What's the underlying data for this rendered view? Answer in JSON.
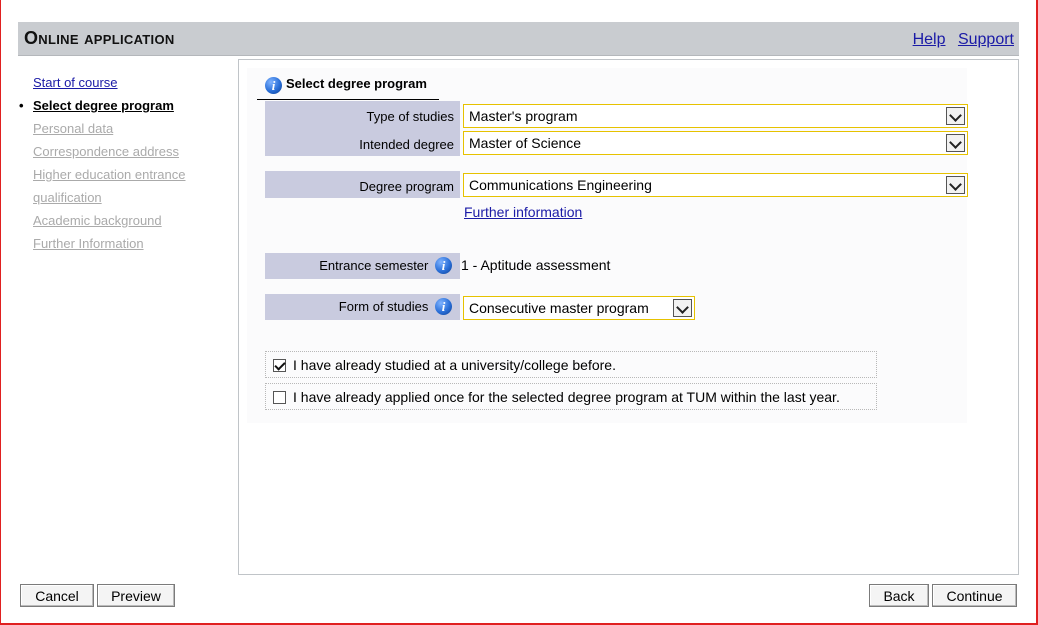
{
  "header": {
    "title": "Online application",
    "help_link": "Help",
    "support_link": "Support"
  },
  "sidebar": {
    "items": [
      {
        "label": "Start of course",
        "state": "done"
      },
      {
        "label": "Select degree program",
        "state": "current"
      },
      {
        "label": "Personal data",
        "state": "disabled"
      },
      {
        "label": "Correspondence address",
        "state": "disabled"
      },
      {
        "label": "Higher education entrance",
        "state": "disabled"
      },
      {
        "label": "qualification",
        "state": "disabled"
      },
      {
        "label": "Academic background",
        "state": "disabled"
      },
      {
        "label": "Further Information",
        "state": "disabled"
      }
    ]
  },
  "section": {
    "title": "Select degree program"
  },
  "form": {
    "type_of_studies": {
      "label": "Type of studies",
      "value": "Master's program"
    },
    "intended_degree": {
      "label": "Intended degree",
      "value": "Master of Science"
    },
    "degree_program": {
      "label": "Degree program",
      "value": "Communications Engineering"
    },
    "further_information_link": "Further information",
    "entrance_semester": {
      "label": "Entrance semester",
      "value": "1 - Aptitude assessment"
    },
    "form_of_studies": {
      "label": "Form of studies",
      "value": "Consecutive master program"
    },
    "checkbox_studied_before": {
      "label": "I have already studied at a university/college before.",
      "checked": true
    },
    "checkbox_applied_before": {
      "label": "I have already applied once for the selected degree program at TUM within the last year.",
      "checked": false
    }
  },
  "footer": {
    "cancel": "Cancel",
    "preview": "Preview",
    "back": "Back",
    "continue": "Continue"
  },
  "colors": {
    "header_bg": "#c9ccd0",
    "label_bg": "#c9cbdf",
    "select_border": "#e6c200",
    "link": "#1a1aa6"
  }
}
